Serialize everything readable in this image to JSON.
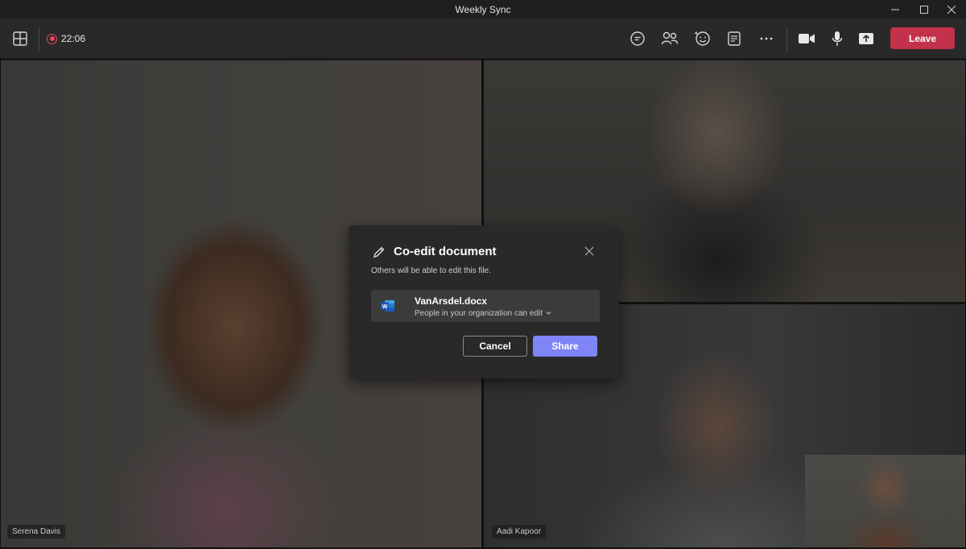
{
  "window": {
    "title": "Weekly Sync"
  },
  "toolbar": {
    "recording_time": "22:06",
    "leave_label": "Leave",
    "icons": [
      "grid-view-icon",
      "chat-icon",
      "people-icon",
      "reactions-icon",
      "notes-icon",
      "more-icon",
      "camera-icon",
      "mic-icon",
      "share-tray-icon"
    ]
  },
  "participants": [
    {
      "name": "Serena Davis"
    },
    {
      "name": ""
    },
    {
      "name": "Aadi Kapoor"
    },
    {
      "name": ""
    }
  ],
  "dialog": {
    "title": "Co-edit document",
    "subtitle": "Others will be able to edit this file.",
    "file_name": "VanArsdel.docx",
    "permission": "People in your organization can edit",
    "cancel_label": "Cancel",
    "share_label": "Share"
  },
  "colors": {
    "leave": "#c4314b",
    "share": "#7f85f5",
    "recording": "#e8475b"
  }
}
